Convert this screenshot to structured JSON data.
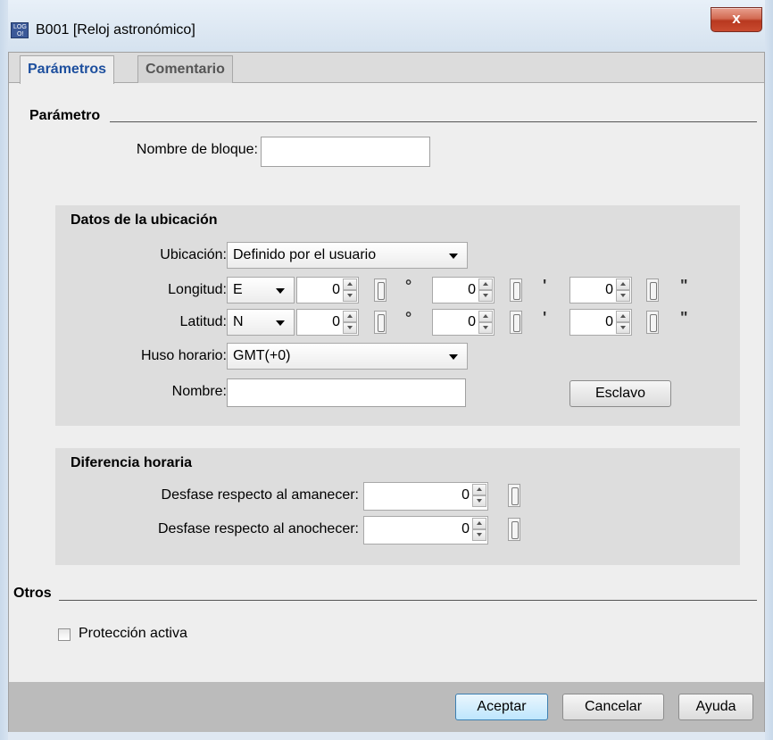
{
  "window": {
    "title": "B001 [Reloj astronómico]",
    "close_symbol": "x",
    "icon": "logo-icon"
  },
  "tabs": [
    {
      "label": "Parámetros",
      "active": true
    },
    {
      "label": "Comentario",
      "active": false
    }
  ],
  "parametro": {
    "section_title": "Parámetro",
    "block_name_label": "Nombre de bloque:",
    "block_name_value": ""
  },
  "ubicacion": {
    "group_title": "Datos de la ubicación",
    "location_label": "Ubicación:",
    "location_value": "Definido por el usuario",
    "longitude_label": "Longitud:",
    "longitude_dir": "E",
    "longitude_deg": "0",
    "longitude_min": "0",
    "longitude_sec": "0",
    "latitude_label": "Latitud:",
    "latitude_dir": "N",
    "latitude_deg": "0",
    "latitude_min": "0",
    "latitude_sec": "0",
    "unit_deg": "°",
    "unit_min": "'",
    "unit_sec": "\"",
    "timezone_label": "Huso horario:",
    "timezone_value": "GMT(+0)",
    "name_label": "Nombre:",
    "name_value": "",
    "slave_button": "Esclavo"
  },
  "diferencia": {
    "group_title": "Diferencia horaria",
    "sunrise_label": "Desfase respecto al amanecer:",
    "sunrise_value": "0",
    "sunset_label": "Desfase respecto al anochecer:",
    "sunset_value": "0"
  },
  "otros": {
    "section_title": "Otros",
    "protection_label": "Protección activa",
    "protection_checked": false
  },
  "footer": {
    "ok": "Aceptar",
    "cancel": "Cancelar",
    "help": "Ayuda"
  }
}
